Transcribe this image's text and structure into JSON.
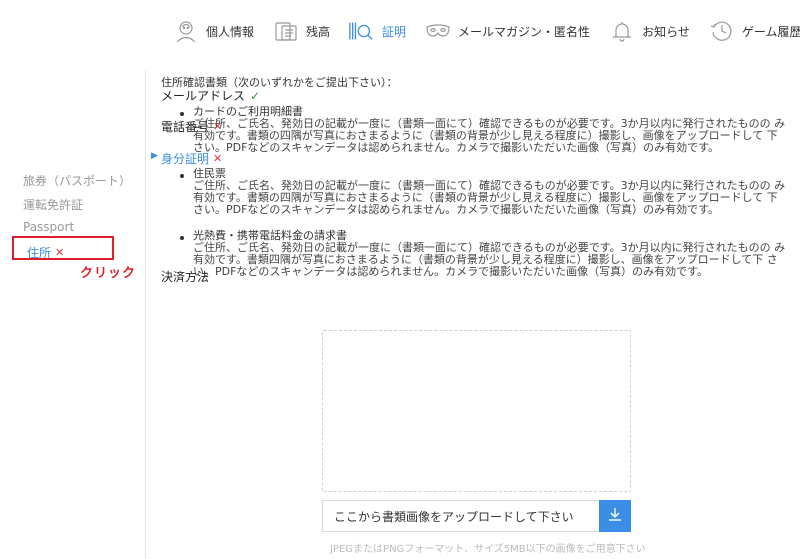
{
  "nav": {
    "items": [
      {
        "label": "個人情報",
        "icon": "person-icon"
      },
      {
        "label": "残高",
        "icon": "wallet-icon"
      },
      {
        "label": "証明",
        "icon": "id-card-icon",
        "active": true
      },
      {
        "label": "メールマガジン・匿名性",
        "icon": "mask-icon"
      },
      {
        "label": "お知らせ",
        "icon": "bell-icon"
      },
      {
        "label": "ゲーム履歴",
        "icon": "history-icon"
      }
    ],
    "active_color": "#3a8ee6"
  },
  "sidebar": {
    "email": {
      "label": "メールアドレス",
      "status": "✓"
    },
    "phone": {
      "label": "電話番号",
      "status": "✕"
    },
    "identity": {
      "label": "身分証明",
      "status": "✕"
    },
    "passport_jp": {
      "label": "旅券（パスポート）"
    },
    "license": {
      "label": "運転免許証"
    },
    "passport": {
      "label": "Passport"
    },
    "address": {
      "label": "住所",
      "status": "✕"
    },
    "payment": {
      "label": "決済方法"
    },
    "annotation": "クリック"
  },
  "main": {
    "intro": "住所確認書類（次のいずれかをご提出下さい）：",
    "documents": [
      {
        "title": "カードのご利用明細書",
        "desc": "ご住所、ご氏名、発効日の記載が一度に（書類一面にて）確認できるものが必要です。3か月以内に発行されたものの み有効です。書類の四隅が写真におさまるように（書類の背景が少し見える程度に）撮影し、画像をアップロードして 下さい。PDFなどのスキャンデータは認められません。カメラで撮影いただいた画像（写真）のみ有効です。"
      },
      {
        "title": "住民票",
        "desc": "ご住所、ご氏名、発効日の記載が一度に（書類一面にて）確認できるものが必要です。3か月以内に発行されたものの み有効です。書類の四隅が写真におさまるように（書類の背景が少し見える程度に）撮影し、画像をアップロードして 下さい。PDFなどのスキャンデータは認められません。カメラで撮影いただいた画像（写真）のみ有効です。"
      },
      {
        "title": "光熱費・携帯電話料金の請求書",
        "desc": "ご住所、ご氏名、発効日の記載が一度に（書類一面にて）確認できるものが必要です。3か月以内に発行されたものの み有効です。書類四隅が写真におさまるように（書類の背景が少し見える程度に）撮影し、画像をアップロードして下 さい。PDFなどのスキャンデータは認められません。カメラで撮影いただいた画像（写真）のみ有効です。"
      }
    ],
    "upload_placeholder": "ここから書類画像をアップロードして下さい",
    "upload_note": "JPEGまたはPNGフォーマット、サイズ5MB以下の画像をご用意下さい"
  }
}
